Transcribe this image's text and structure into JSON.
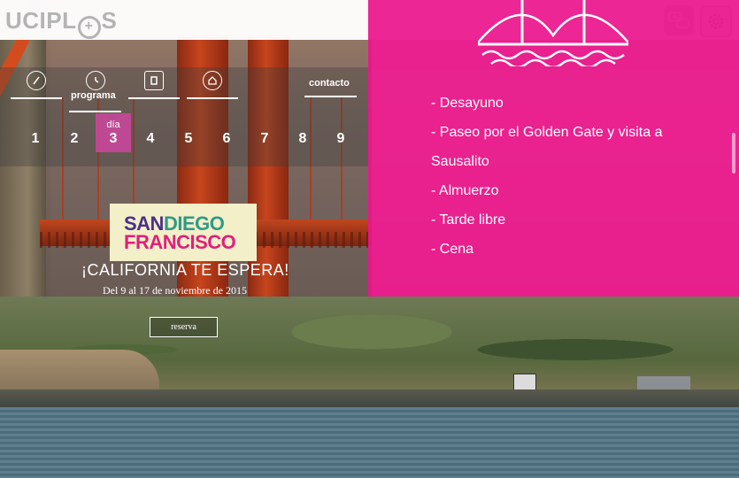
{
  "header": {
    "logo_left": "UCIPL",
    "logo_plus": "+",
    "logo_right": "S",
    "buttons": [
      {
        "icon": "chat-bubbles-icon"
      },
      {
        "icon": "gear-icon"
      }
    ]
  },
  "nav": {
    "items": [
      {
        "icon": "compass-icon",
        "label": ""
      },
      {
        "icon": "clock-icon",
        "label": "programa"
      },
      {
        "icon": "hotel-icon",
        "label": ""
      },
      {
        "icon": "home-icon",
        "label": ""
      },
      {
        "icon": "",
        "label": "contacto"
      }
    ],
    "day_label": "día",
    "days": [
      "1",
      "2",
      "3",
      "4",
      "5",
      "6",
      "7",
      "8",
      "9"
    ],
    "active_day": "3"
  },
  "itinerary": {
    "items": [
      "- Desayuno",
      "- Paseo por el Golden Gate y visita a",
      "Sausalito",
      "- Almuerzo",
      "- Tarde libre",
      "- Cena"
    ]
  },
  "campaign": {
    "line1_a": "SAN",
    "line1_b": "DIEGO",
    "line2": "FRANCISCO",
    "tagline": "¡CALIFORNIA TE ESPERA!",
    "dates": "Del 9 al 17 de noviembre de 2015",
    "reserve_label": "reserva"
  },
  "colors": {
    "pink": "#eb168c",
    "badge_bg": "#f3efc8",
    "badge_purple": "#4b2f8a",
    "badge_teal": "#2f9a86",
    "badge_pink": "#e0207a"
  }
}
